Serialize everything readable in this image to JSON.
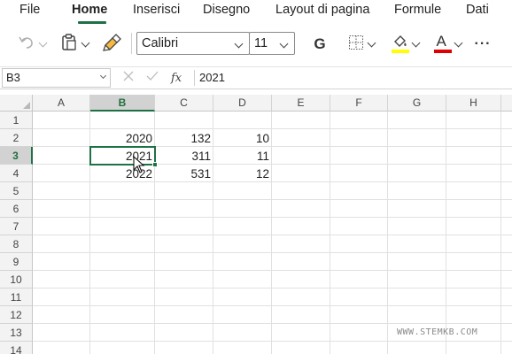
{
  "ribbon": {
    "tabs": [
      {
        "label": "File",
        "active": false
      },
      {
        "label": "Home",
        "active": true
      },
      {
        "label": "Inserisci",
        "active": false
      },
      {
        "label": "Disegno",
        "active": false
      },
      {
        "label": "Layout di pagina",
        "active": false
      },
      {
        "label": "Formule",
        "active": false
      },
      {
        "label": "Dati",
        "active": false
      }
    ],
    "accent_color": "#1e7145"
  },
  "toolbar": {
    "font_name": "Calibri",
    "font_size": "11",
    "bold_label": "G",
    "font_color_letter": "A",
    "more_label": "···",
    "fill_color": "#ffff00",
    "font_color": "#e00000",
    "icons": [
      "undo-icon",
      "paste-icon",
      "format-painter-icon",
      "borders-icon",
      "fill-color-icon",
      "font-color-icon",
      "more-icon"
    ]
  },
  "formula_bar": {
    "name_box": "B3",
    "fx_label": "fx",
    "formula": "2021"
  },
  "sheet": {
    "columns": [
      "A",
      "B",
      "C",
      "D",
      "E",
      "F",
      "G",
      "H"
    ],
    "selected_column": "B",
    "rows": [
      "1",
      "2",
      "3",
      "4",
      "5",
      "6",
      "7",
      "8",
      "9",
      "10",
      "11",
      "12",
      "13",
      "14"
    ],
    "selected_row": "3",
    "cells": {
      "B2": "2020",
      "C2": "132",
      "D2": "10",
      "B3": "2021",
      "C3": "311",
      "D3": "11",
      "B4": "2022",
      "C4": "531",
      "D4": "12"
    },
    "active_cell": "B3"
  },
  "watermark": "WWW.STEMKB.COM"
}
